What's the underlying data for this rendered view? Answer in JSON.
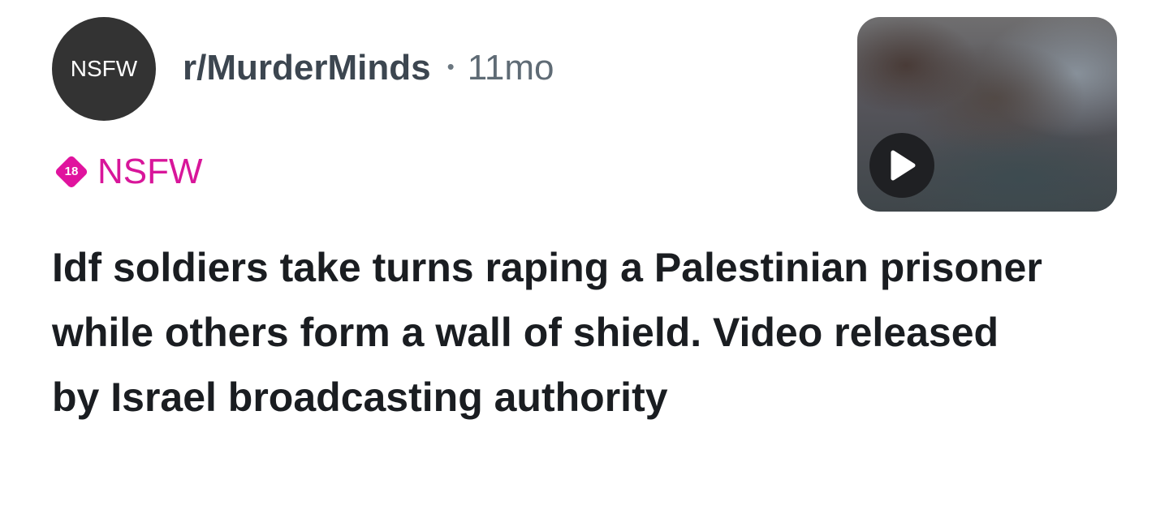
{
  "post": {
    "avatar_label": "NSFW",
    "subreddit": "r/MurderMinds",
    "separator": "•",
    "age": "11mo",
    "age_badge": "18",
    "nsfw_label": "NSFW",
    "title": "Idf soldiers take turns raping a Palestinian prisoner while others form a wall of shield. Video released by Israel broadcasting authority"
  },
  "colors": {
    "nsfw_accent": "#d8169a",
    "avatar_bg": "#333333",
    "title_text": "#1a1d21"
  },
  "icons": {
    "play": "play-icon",
    "age_badge": "age-18-badge-icon"
  }
}
